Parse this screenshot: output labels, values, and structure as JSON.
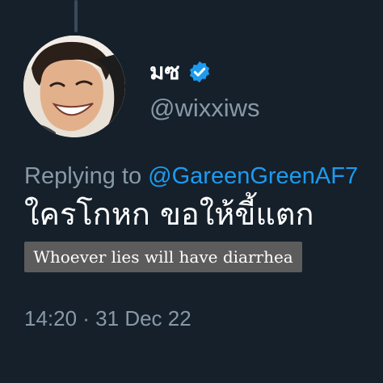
{
  "tweet": {
    "display_name": "มซ",
    "handle": "@wixxiws",
    "replying_prefix": "Replying to ",
    "replying_to": "@GareenGreenAF7",
    "text": "ใครโกหก ขอให้ขี้แตก",
    "timestamp": "14:20 · 31 Dec 22"
  },
  "caption": {
    "text": "Whoever lies will have diarrhea"
  },
  "icons": {
    "verified": "verified-badge-icon"
  },
  "colors": {
    "background": "#15202b",
    "secondary_text": "#8899a6",
    "accent": "#1d9bf0",
    "caption_bg": "#5c5c5c"
  }
}
